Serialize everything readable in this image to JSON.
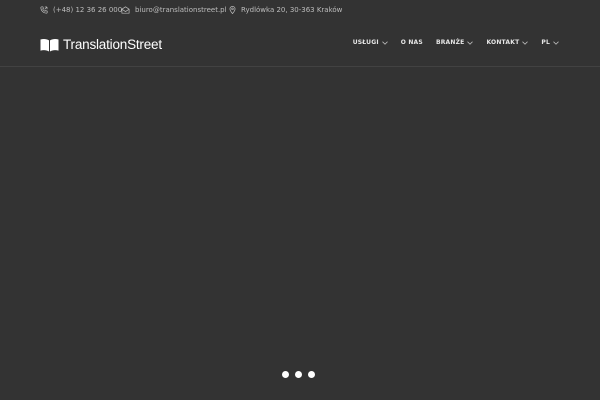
{
  "topbar": {
    "phone": "(+48) 12 36 26 000",
    "email": "biuro@translationstreet.pl",
    "address": "Rydlówka 20, 30-363 Kraków",
    "phone_icon": "phone-icon",
    "email_icon": "envelope-icon",
    "address_icon": "map-pin-icon"
  },
  "header": {
    "logo_text": "TranslationStreet",
    "logo_icon": "open-book-icon",
    "nav": [
      {
        "label": "USŁUGI",
        "has_dropdown": true
      },
      {
        "label": "O NAS",
        "has_dropdown": false
      },
      {
        "label": "BRANŻE",
        "has_dropdown": true
      },
      {
        "label": "KONTAKT",
        "has_dropdown": true
      },
      {
        "label": "PL",
        "has_dropdown": true
      }
    ]
  },
  "slider": {
    "slide_count": 3
  },
  "colors": {
    "background": "#333333",
    "text_light": "#e6e6e6",
    "text_muted": "#bdbdbd",
    "divider": "#424242"
  }
}
